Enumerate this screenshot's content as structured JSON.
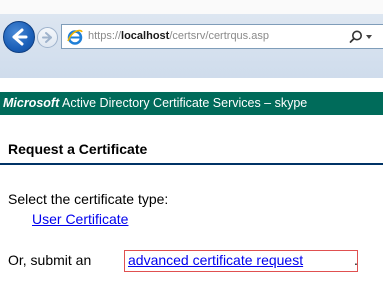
{
  "browser": {
    "url_scheme": "https://",
    "url_host": "localhost",
    "url_path": "/certsrv/certrqus.asp",
    "search_icon": "search-icon",
    "dropdown_icon": "chevron-down-icon",
    "accent_color": "#1b5fb8"
  },
  "banner": {
    "brand": "Microsoft",
    "text": "Active Directory Certificate Services  –  skype",
    "color": "#006b5a"
  },
  "page": {
    "title": "Request a Certificate",
    "prompt": "Select the certificate type:",
    "user_cert_link": "User Certificate",
    "submit_prefix": "Or, submit an",
    "advanced_link": "advanced certificate request",
    "submit_suffix": "."
  }
}
